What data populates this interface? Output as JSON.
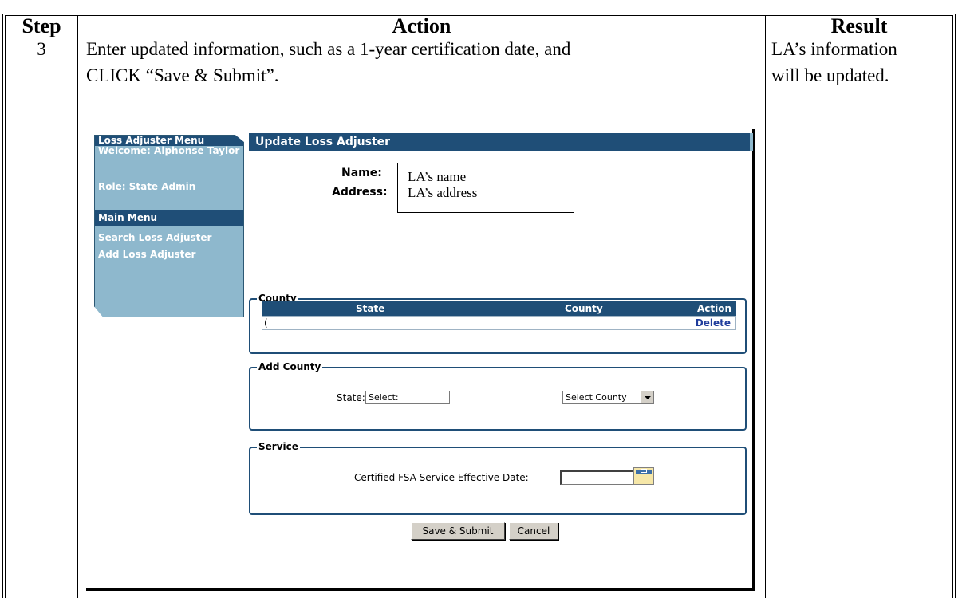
{
  "table": {
    "headers": {
      "step": "Step",
      "action": "Action",
      "result": "Result"
    },
    "row": {
      "step": "3",
      "action_line1": "Enter updated information, such as a 1-year certification date, and",
      "action_line2": "CLICK “Save & Submit”.",
      "result_line1": "LA’s information",
      "result_line2": "will be updated."
    }
  },
  "screen": {
    "sidebar": {
      "menu_title": "Loss Adjuster Menu",
      "welcome": "Welcome: Alphonse Taylor",
      "role": "Role: State Admin",
      "main_menu": "Main Menu",
      "items": [
        {
          "label": "Search Loss Adjuster"
        },
        {
          "label": "Add Loss Adjuster"
        }
      ]
    },
    "title": "Update Loss Adjuster",
    "name_label": "Name:",
    "address_label": "Address:",
    "callout": {
      "name": "LA’s name",
      "address": "LA’s address"
    },
    "county_section": {
      "legend": "County",
      "columns": [
        "State",
        "County",
        "Action"
      ],
      "row": {
        "state": "(",
        "action": "Delete"
      }
    },
    "add_county_section": {
      "legend": "Add County",
      "state_label": "State:",
      "state_value": "Select:",
      "county_value": "Select County"
    },
    "service_section": {
      "legend": "Service",
      "date_label": "Certified FSA Service Effective Date:",
      "date_value": ""
    },
    "buttons": {
      "save": "Save & Submit",
      "cancel": "Cancel"
    }
  },
  "colors": {
    "nav_dark": "#1f4e77",
    "nav_light": "#8eb8cd",
    "link": "#1f3c9c"
  }
}
